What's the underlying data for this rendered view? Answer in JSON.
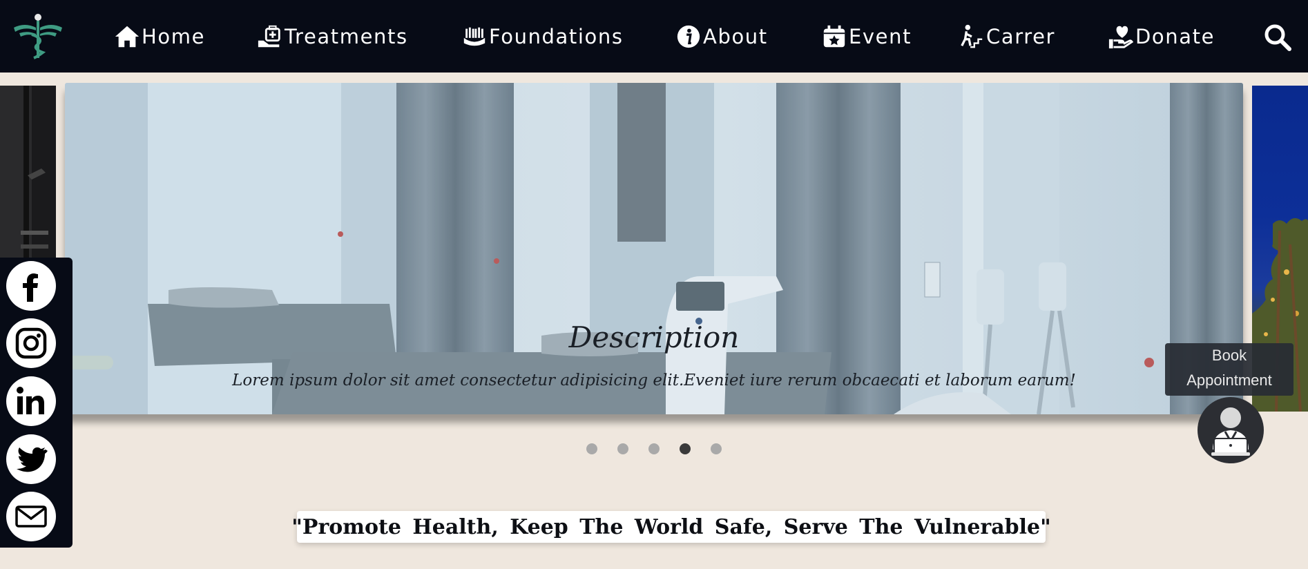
{
  "brand": {
    "logo_icon": "caduceus-logo-icon",
    "accent_color": "#3f9c83"
  },
  "nav": {
    "items": [
      {
        "label": "Home",
        "icon": "home-icon"
      },
      {
        "label": "Treatments",
        "icon": "medical-kit-hand-icon"
      },
      {
        "label": "Foundations",
        "icon": "helping-hands-icon"
      },
      {
        "label": "About",
        "icon": "info-icon"
      },
      {
        "label": "Event",
        "icon": "calendar-star-icon"
      },
      {
        "label": "Carrer",
        "icon": "career-stairs-icon"
      },
      {
        "label": "Donate",
        "icon": "hand-heart-icon"
      }
    ],
    "search_icon": "search-icon"
  },
  "carousel": {
    "caption_title": "Description",
    "caption_text": "Lorem ipsum dolor sit amet consectetur adipisicing elit.Eveniet iure rerum obcaecati et laborum earum!",
    "slide_count": 5,
    "active_index": 3
  },
  "social": [
    "facebook-icon",
    "instagram-icon",
    "linkedin-icon",
    "twitter-icon",
    "mail-icon"
  ],
  "book": {
    "line1": "Book",
    "line2": "Appointment"
  },
  "quote": "\"Promote Health, Keep The World Safe, Serve The Vulnerable\""
}
